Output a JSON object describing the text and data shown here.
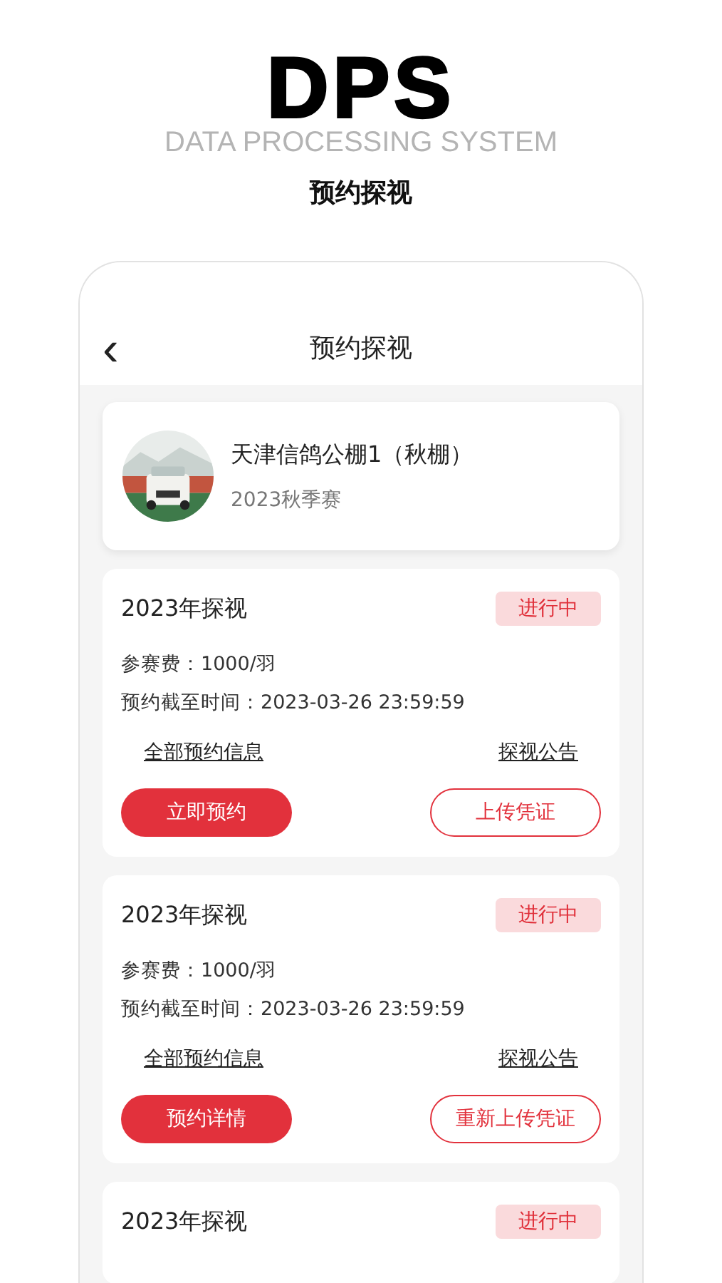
{
  "logo": {
    "title": "DPS",
    "subtitle": "DATA PROCESSING SYSTEM"
  },
  "page_caption": "预约探视",
  "header": {
    "back": "‹",
    "title": "预约探视"
  },
  "venue": {
    "name": "天津信鸽公棚1（秋棚）",
    "season": "2023秋季赛"
  },
  "events": [
    {
      "title": "2023年探视",
      "status": "进行中",
      "fee": "参赛费：1000/羽",
      "deadline": "预约截至时间：2023-03-26  23:59:59",
      "links": [
        "全部预约信息",
        "探视公告"
      ],
      "primary": "立即预约",
      "secondary": "上传凭证"
    },
    {
      "title": "2023年探视",
      "status": "进行中",
      "fee": "参赛费：1000/羽",
      "deadline": "预约截至时间：2023-03-26  23:59:59",
      "links": [
        "全部预约信息",
        "探视公告"
      ],
      "primary": "预约详情",
      "secondary": "重新上传凭证"
    },
    {
      "title": "2023年探视",
      "status": "进行中"
    }
  ]
}
